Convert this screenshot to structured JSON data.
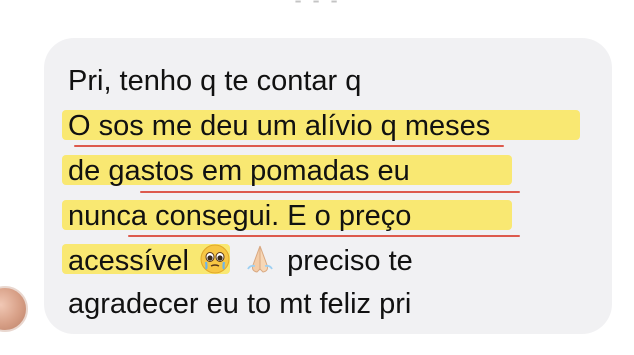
{
  "message": {
    "lines": [
      "Pri, tenho q te contar q",
      "O sos me deu um alívio q meses",
      "de gastos em pomadas eu",
      "nunca consegui. E o preço",
      "acessível",
      "preciso te",
      "agradecer eu to mt feliz pri"
    ],
    "emojis": [
      "teary-smiling-face-icon",
      "praying-hands-icon"
    ],
    "highlight_color": "#fbe64d",
    "bubble_color": "#f1f1f3",
    "underline_color": "#d9402f"
  }
}
